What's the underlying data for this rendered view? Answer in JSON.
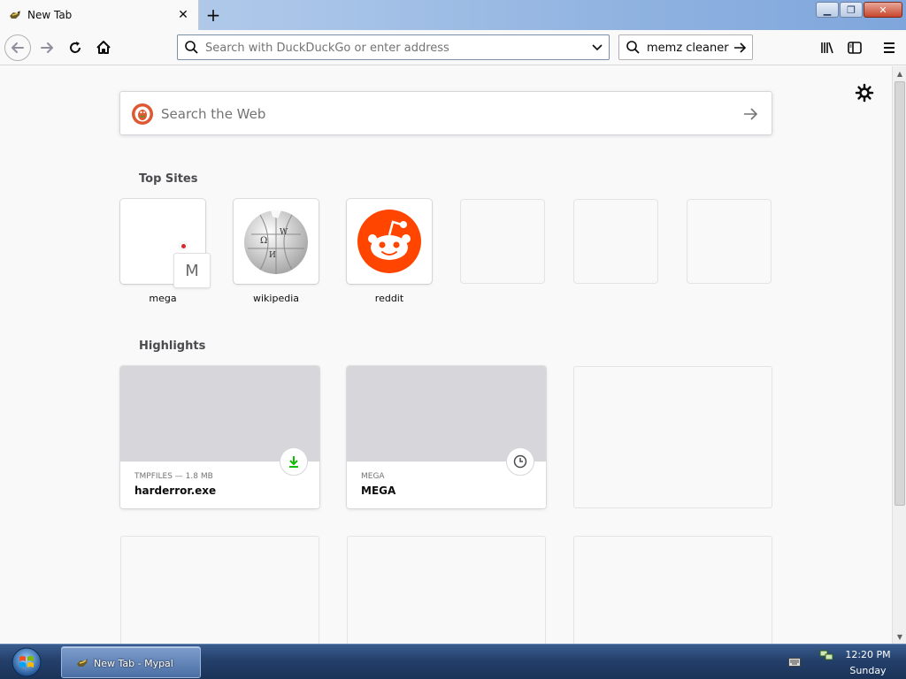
{
  "tab": {
    "title": "New Tab"
  },
  "urlbar": {
    "placeholder": "Search with DuckDuckGo or enter address"
  },
  "searchbar": {
    "value": "memz cleaner"
  },
  "websearch": {
    "placeholder": "Search the Web"
  },
  "top_sites": {
    "title": "Top Sites",
    "items": [
      {
        "label": "mega"
      },
      {
        "label": "wikipedia"
      },
      {
        "label": "reddit"
      }
    ],
    "mega_letter": "M"
  },
  "highlights": {
    "title": "Highlights",
    "items": [
      {
        "meta": "TMPFILES — 1.8 MB",
        "name": "harderror.exe",
        "badge": "download-icon"
      },
      {
        "meta": "MEGA",
        "name": "MEGA",
        "badge": "clock-icon"
      }
    ]
  },
  "taskbar": {
    "task_label": "New Tab - Mypal",
    "time": "12:20 PM",
    "day": "Sunday"
  },
  "colors": {
    "reddit": "#ff4500",
    "download": "#12bc00",
    "close": "#c7462c"
  }
}
